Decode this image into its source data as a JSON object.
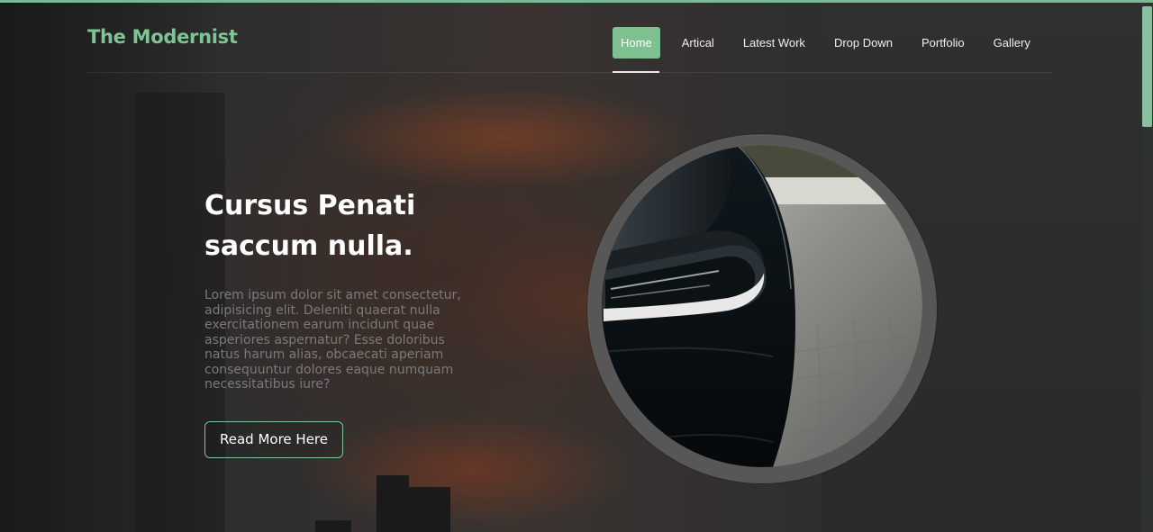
{
  "brand": "The Modernist",
  "nav": {
    "items": [
      "Home",
      "Artical",
      "Latest Work",
      "Drop Down",
      "Portfolio",
      "Gallery"
    ],
    "active": "Home"
  },
  "hero": {
    "title_line1": "Cursus Penati",
    "title_line2": "saccum nulla.",
    "body": "Lorem ipsum dolor sit amet consectetur, adipisicing elit. Deleniti quaerat nulla exercitationem earum incidunt quae asperiores aspernatur? Esse doloribus natus harum alias, obcaecati aperiam consequuntur dolores eaque numquam necessitatibus iure?",
    "cta_label": "Read More Here",
    "image": "car-headlight-photo"
  },
  "colors": {
    "accent": "#7ec595",
    "background": "#2b2b2b",
    "text": "#ffffff",
    "muted_text": "#7a7a7a"
  }
}
